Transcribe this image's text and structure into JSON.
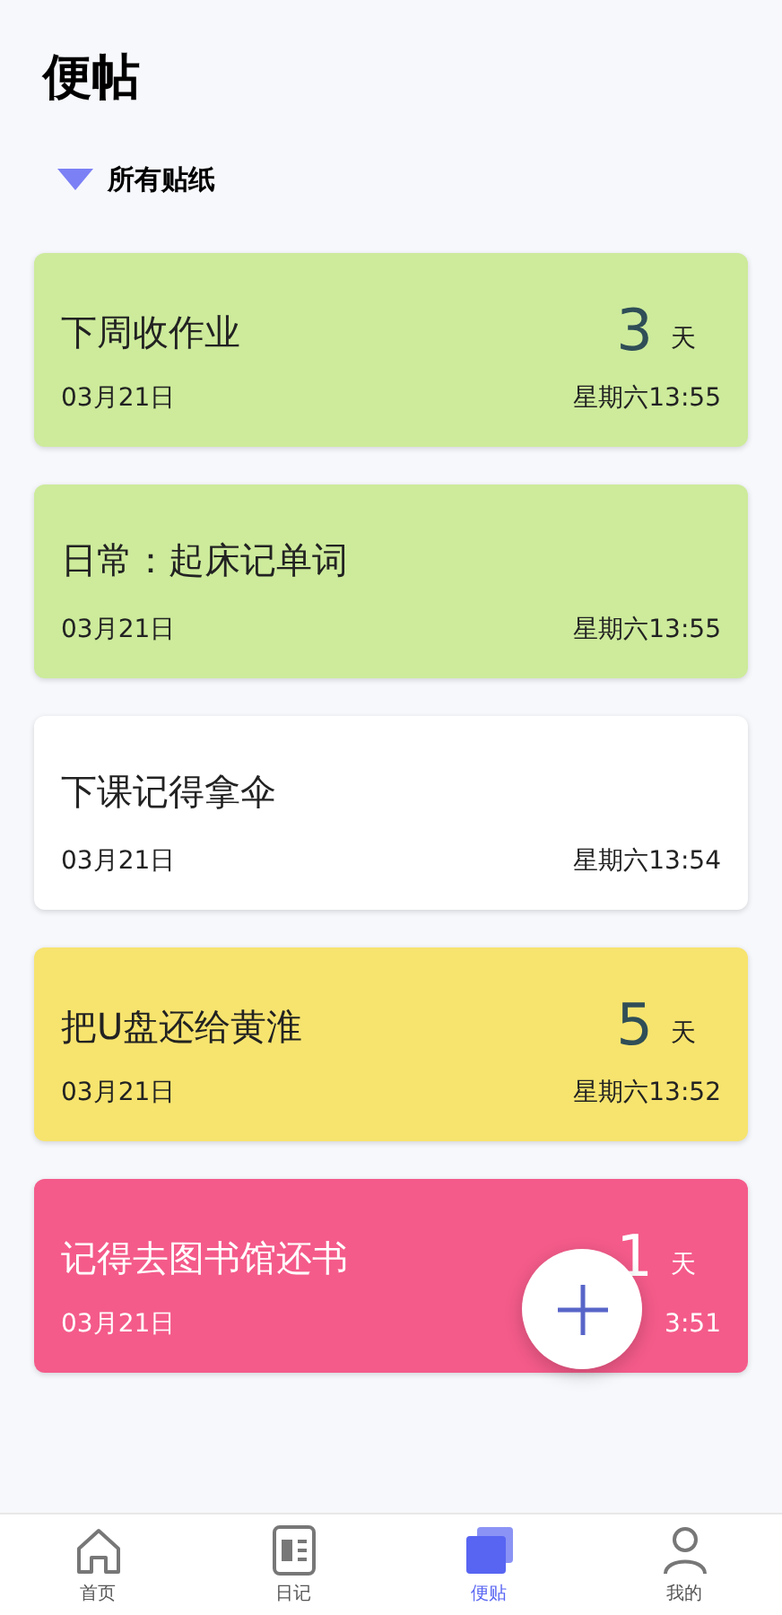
{
  "header": {
    "title": "便帖"
  },
  "filter": {
    "label": "所有贴纸",
    "expanded": true
  },
  "notes": [
    {
      "title": "下周收作业",
      "days": "3",
      "unit": "天",
      "date": "03月21日",
      "time": "星期六13:55",
      "color": "#cdeb9b"
    },
    {
      "title": "日常：起床记单词",
      "date": "03月21日",
      "time": "星期六13:55",
      "color": "#cdeb9b"
    },
    {
      "title": "下课记得拿伞",
      "date": "03月21日",
      "time": "星期六13:54",
      "color": "#ffffff"
    },
    {
      "title": "把U盘还给黄淮",
      "days": "5",
      "unit": "天",
      "date": "03月21日",
      "time": "星期六13:52",
      "color": "#f7e46e"
    },
    {
      "title": "记得去图书馆还书",
      "days": "1",
      "unit": "天",
      "date": "03月21日",
      "time": "3:51",
      "color": "#f45b8a"
    }
  ],
  "nav": [
    {
      "label": "首页",
      "kind": "home",
      "selected": false
    },
    {
      "label": "日记",
      "kind": "diary",
      "selected": false
    },
    {
      "label": "便贴",
      "kind": "notes",
      "selected": true
    },
    {
      "label": "我的",
      "kind": "user",
      "selected": false
    }
  ]
}
